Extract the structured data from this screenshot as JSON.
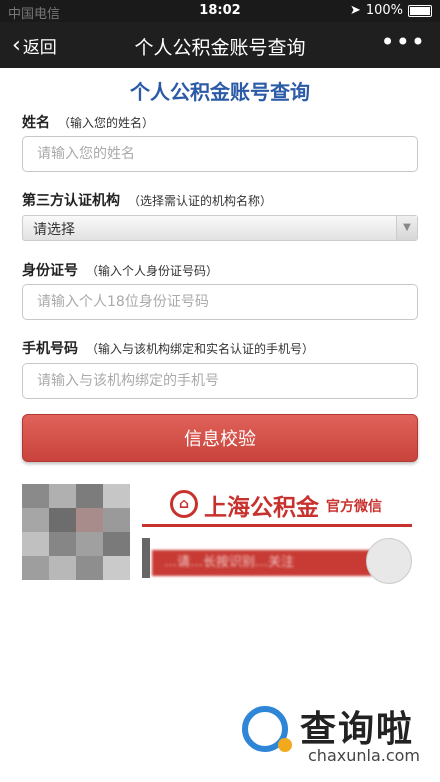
{
  "status_bar": {
    "carrier": "中国电信",
    "time": "18:02",
    "battery": "100%"
  },
  "nav": {
    "back_label": "返回",
    "title": "个人公积金账号查询",
    "more": "•••"
  },
  "form": {
    "heading": "个人公积金账号查询",
    "name": {
      "label": "姓名",
      "hint": "（输入您的姓名）",
      "placeholder": "请输入您的姓名"
    },
    "org": {
      "label": "第三方认证机构",
      "hint": "（选择需认证的机构名称）",
      "value": "请选择"
    },
    "id": {
      "label": "身份证号",
      "hint": "（输入个人身份证号码）",
      "placeholder": "请输入个人18位身份证号码"
    },
    "phone": {
      "label": "手机号码",
      "hint": "（输入与该机构绑定和实名认证的手机号）",
      "placeholder": "请输入与该机构绑定的手机号"
    },
    "submit_label": "信息校验"
  },
  "banner": {
    "brand": "上海公积金",
    "brand_sub": "官方微信",
    "strip_text": "…请…长按识别…关注"
  },
  "watermark": {
    "text": "查询啦",
    "url": "chaxunla.com"
  },
  "colors": {
    "accent_red": "#c8322e",
    "heading_blue": "#2b5aa6",
    "nav_bg": "#1f1f1f"
  }
}
